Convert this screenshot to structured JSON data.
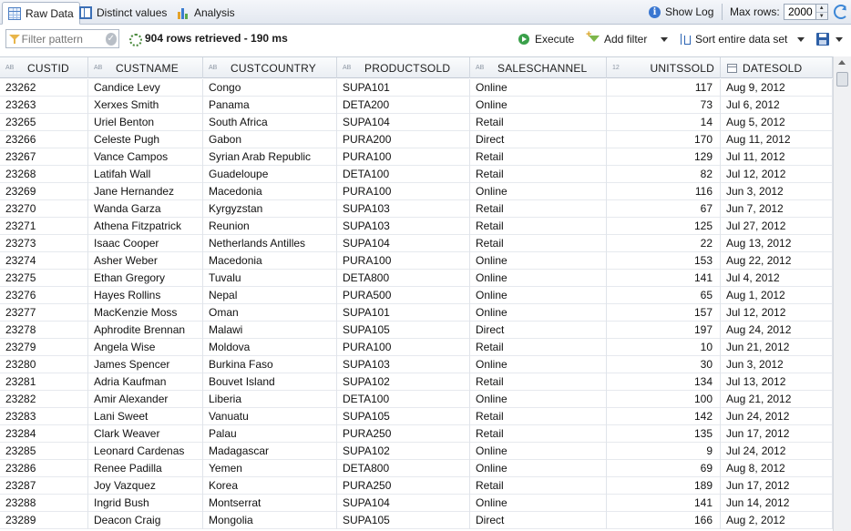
{
  "tabs": [
    {
      "label": "Raw Data",
      "icon": "grid-icon",
      "active": true
    },
    {
      "label": "Distinct values",
      "icon": "table-icon",
      "active": false
    },
    {
      "label": "Analysis",
      "icon": "bar-chart-icon",
      "active": false
    }
  ],
  "topbar": {
    "show_log": "Show Log",
    "max_rows_label": "Max rows:",
    "max_rows_value": "2000"
  },
  "toolbar": {
    "filter_placeholder": "Filter pattern",
    "status": "904 rows retrieved - 190 ms",
    "execute": "Execute",
    "add_filter": "Add filter",
    "sort": "Sort entire data set"
  },
  "columns": [
    {
      "name": "CUSTID",
      "type": "AB"
    },
    {
      "name": "CUSTNAME",
      "type": "AB"
    },
    {
      "name": "CUSTCOUNTRY",
      "type": "AB"
    },
    {
      "name": "PRODUCTSOLD",
      "type": "AB"
    },
    {
      "name": "SALESCHANNEL",
      "type": "AB"
    },
    {
      "name": "UNITSSOLD",
      "type": "12"
    },
    {
      "name": "DATESOLD",
      "type": "date"
    }
  ],
  "rows": [
    [
      "23262",
      "Candice Levy",
      "Congo",
      "SUPA101",
      "Online",
      "117",
      "Aug 9, 2012"
    ],
    [
      "23263",
      "Xerxes Smith",
      "Panama",
      "DETA200",
      "Online",
      "73",
      "Jul 6, 2012"
    ],
    [
      "23265",
      "Uriel Benton",
      "South Africa",
      "SUPA104",
      "Retail",
      "14",
      "Aug 5, 2012"
    ],
    [
      "23266",
      "Celeste Pugh",
      "Gabon",
      "PURA200",
      "Direct",
      "170",
      "Aug 11, 2012"
    ],
    [
      "23267",
      "Vance Campos",
      "Syrian Arab Republic",
      "PURA100",
      "Retail",
      "129",
      "Jul 11, 2012"
    ],
    [
      "23268",
      "Latifah Wall",
      "Guadeloupe",
      "DETA100",
      "Retail",
      "82",
      "Jul 12, 2012"
    ],
    [
      "23269",
      "Jane Hernandez",
      "Macedonia",
      "PURA100",
      "Online",
      "116",
      "Jun 3, 2012"
    ],
    [
      "23270",
      "Wanda Garza",
      "Kyrgyzstan",
      "SUPA103",
      "Retail",
      "67",
      "Jun 7, 2012"
    ],
    [
      "23271",
      "Athena Fitzpatrick",
      "Reunion",
      "SUPA103",
      "Retail",
      "125",
      "Jul 27, 2012"
    ],
    [
      "23273",
      "Isaac Cooper",
      "Netherlands Antilles",
      "SUPA104",
      "Retail",
      "22",
      "Aug 13, 2012"
    ],
    [
      "23274",
      "Asher Weber",
      "Macedonia",
      "PURA100",
      "Online",
      "153",
      "Aug 22, 2012"
    ],
    [
      "23275",
      "Ethan Gregory",
      "Tuvalu",
      "DETA800",
      "Online",
      "141",
      "Jul 4, 2012"
    ],
    [
      "23276",
      "Hayes Rollins",
      "Nepal",
      "PURA500",
      "Online",
      "65",
      "Aug 1, 2012"
    ],
    [
      "23277",
      "MacKenzie Moss",
      "Oman",
      "SUPA101",
      "Online",
      "157",
      "Jul 12, 2012"
    ],
    [
      "23278",
      "Aphrodite Brennan",
      "Malawi",
      "SUPA105",
      "Direct",
      "197",
      "Aug 24, 2012"
    ],
    [
      "23279",
      "Angela Wise",
      "Moldova",
      "PURA100",
      "Retail",
      "10",
      "Jun 21, 2012"
    ],
    [
      "23280",
      "James Spencer",
      "Burkina Faso",
      "SUPA103",
      "Online",
      "30",
      "Jun 3, 2012"
    ],
    [
      "23281",
      "Adria Kaufman",
      "Bouvet Island",
      "SUPA102",
      "Retail",
      "134",
      "Jul 13, 2012"
    ],
    [
      "23282",
      "Amir Alexander",
      "Liberia",
      "DETA100",
      "Online",
      "100",
      "Aug 21, 2012"
    ],
    [
      "23283",
      "Lani Sweet",
      "Vanuatu",
      "SUPA105",
      "Retail",
      "142",
      "Jun 24, 2012"
    ],
    [
      "23284",
      "Clark Weaver",
      "Palau",
      "PURA250",
      "Retail",
      "135",
      "Jun 17, 2012"
    ],
    [
      "23285",
      "Leonard Cardenas",
      "Madagascar",
      "SUPA102",
      "Online",
      "9",
      "Jul 24, 2012"
    ],
    [
      "23286",
      "Renee Padilla",
      "Yemen",
      "DETA800",
      "Online",
      "69",
      "Aug 8, 2012"
    ],
    [
      "23287",
      "Joy Vazquez",
      "Korea",
      "PURA250",
      "Retail",
      "189",
      "Jun 17, 2012"
    ],
    [
      "23288",
      "Ingrid Bush",
      "Montserrat",
      "SUPA104",
      "Online",
      "141",
      "Jun 14, 2012"
    ],
    [
      "23289",
      "Deacon Craig",
      "Mongolia",
      "SUPA105",
      "Direct",
      "166",
      "Aug 2, 2012"
    ]
  ]
}
